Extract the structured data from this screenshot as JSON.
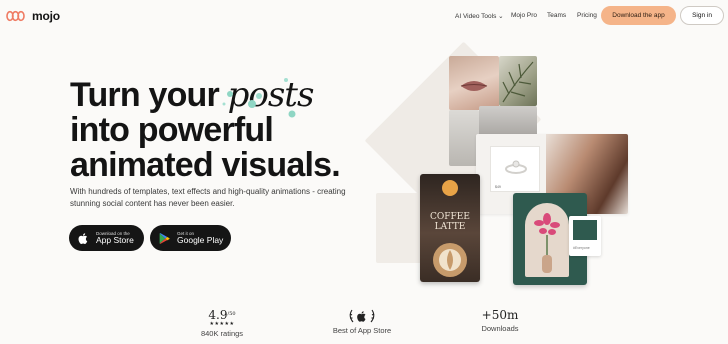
{
  "brand": {
    "name": "mojo",
    "accent": "#f5b489"
  },
  "nav": {
    "items": [
      {
        "label": "AI Video Tools",
        "has_dropdown": true
      },
      {
        "label": "Mojo Pro"
      },
      {
        "label": "Teams"
      },
      {
        "label": "Pricing"
      }
    ],
    "download_label": "Download the app",
    "signin_label": "Sign in"
  },
  "hero": {
    "headline_line1_a": "Turn your",
    "headline_line1_b": "posts",
    "headline_line2": "into powerful",
    "headline_line3": "animated visuals.",
    "subtext": "With hundreds of templates, text effects and high-quality animations - creating stunning social content has never been easier."
  },
  "stores": {
    "apple": {
      "small": "Download on the",
      "big": "App Store",
      "icon": "apple-icon"
    },
    "google": {
      "small": "Get it on",
      "big": "Google Play",
      "icon": "google-play-icon"
    }
  },
  "collage": {
    "coffee_line1": "COFFEE",
    "coffee_line2": "LATTE",
    "tag_text": "#Everyone",
    "ring_caption": "$49"
  },
  "stats": [
    {
      "value": "4.9",
      "suffix": "/50",
      "label": "840K ratings",
      "stars": "★★★★★"
    },
    {
      "value": "",
      "label": "Best of App Store",
      "icon": "apple-laurel-icon"
    },
    {
      "value": "+50m",
      "label": "Downloads"
    }
  ]
}
